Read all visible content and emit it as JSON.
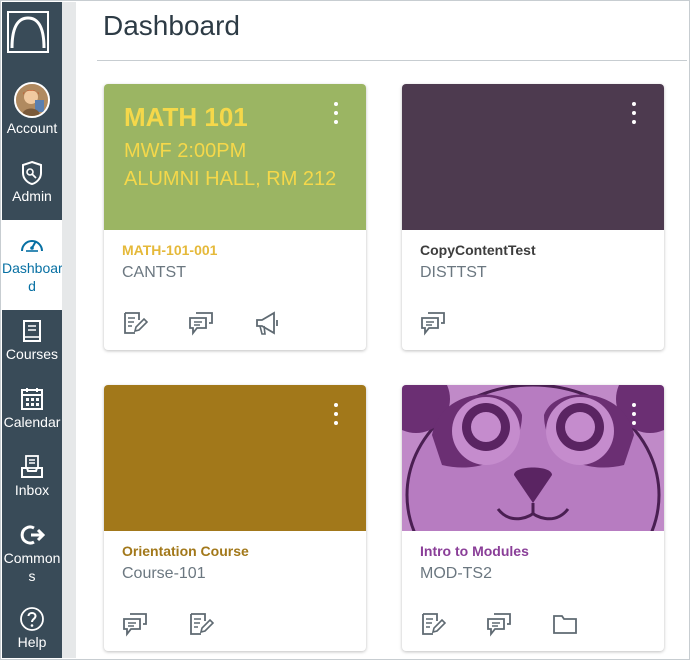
{
  "header": {
    "title": "Dashboard"
  },
  "nav": {
    "items": [
      {
        "label": "Account",
        "icon": "avatar"
      },
      {
        "label": "Admin",
        "icon": "shield-icon"
      },
      {
        "label_line1": "Dashboar",
        "label_line2": "d",
        "icon": "dashboard-icon",
        "active": true
      },
      {
        "label": "Courses",
        "icon": "courses-icon"
      },
      {
        "label": "Calendar",
        "icon": "calendar-icon"
      },
      {
        "label": "Inbox",
        "icon": "inbox-icon"
      },
      {
        "label_line1": "Common",
        "label_line2": "s",
        "icon": "commons-icon"
      },
      {
        "label": "Help",
        "icon": "help-icon"
      }
    ]
  },
  "cards": [
    {
      "hero_color": "#9bb563",
      "hero_lines": [
        "MATH 101",
        "MWF 2:00PM",
        "ALUMNI HALL, RM 212"
      ],
      "course_code": "MATH-101-001",
      "code_color": "#e5b93a",
      "term": "CANTST",
      "actions": [
        "assignments-icon",
        "discussions-icon",
        "announcements-icon"
      ]
    },
    {
      "hero_color": "#4d3a4f",
      "course_code": "CopyContentTest",
      "code_color": "#3d3d3d",
      "term": "DISTTST",
      "actions": [
        "discussions-icon"
      ]
    },
    {
      "hero_color": "#a2781a",
      "course_code": "Orientation Course",
      "code_color": "#a2781a",
      "term": "Course-101",
      "actions": [
        "discussions-icon",
        "assignments-icon"
      ]
    },
    {
      "hero_color": "#c08ac8",
      "course_code": "Intro to Modules",
      "code_color": "#8a3e98",
      "term": "MOD-TS2",
      "actions": [
        "assignments-icon",
        "discussions-icon",
        "files-icon"
      ]
    }
  ],
  "colors": {
    "nav_bg": "#394b58",
    "accent": "#0770a3",
    "title": "#2d3b45"
  }
}
